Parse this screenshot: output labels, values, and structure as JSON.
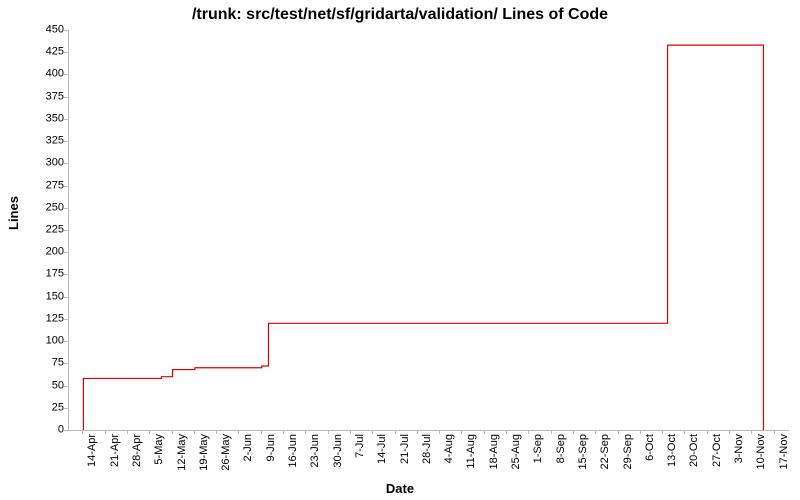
{
  "chart_data": {
    "type": "line",
    "title": "/trunk: src/test/net/sf/gridarta/validation/ Lines of Code",
    "xlabel": "Date",
    "ylabel": "Lines",
    "ylim": [
      0,
      450
    ],
    "y_ticks": [
      0,
      25,
      50,
      75,
      100,
      125,
      150,
      175,
      200,
      225,
      250,
      275,
      300,
      325,
      350,
      375,
      400,
      425,
      450
    ],
    "x_categories": [
      "14-Apr",
      "21-Apr",
      "28-Apr",
      "5-May",
      "12-May",
      "19-May",
      "26-May",
      "2-Jun",
      "9-Jun",
      "16-Jun",
      "23-Jun",
      "30-Jun",
      "7-Jul",
      "14-Jul",
      "21-Jul",
      "28-Jul",
      "4-Aug",
      "11-Aug",
      "18-Aug",
      "25-Aug",
      "1-Sep",
      "8-Sep",
      "15-Sep",
      "22-Sep",
      "29-Sep",
      "6-Oct",
      "13-Oct",
      "20-Oct",
      "27-Oct",
      "3-Nov",
      "10-Nov",
      "17-Nov"
    ],
    "series": [
      {
        "name": "Lines of Code",
        "color": "#e00000",
        "step_points": [
          {
            "x_index": 0.0,
            "y": 0
          },
          {
            "x_index": 0.0,
            "y": 58
          },
          {
            "x_index": 3.5,
            "y": 58
          },
          {
            "x_index": 3.5,
            "y": 60
          },
          {
            "x_index": 4.0,
            "y": 60
          },
          {
            "x_index": 4.0,
            "y": 68
          },
          {
            "x_index": 5.0,
            "y": 68
          },
          {
            "x_index": 5.0,
            "y": 70
          },
          {
            "x_index": 8.0,
            "y": 70
          },
          {
            "x_index": 8.0,
            "y": 72
          },
          {
            "x_index": 8.3,
            "y": 72
          },
          {
            "x_index": 8.3,
            "y": 120
          },
          {
            "x_index": 26.2,
            "y": 120
          },
          {
            "x_index": 26.2,
            "y": 433
          },
          {
            "x_index": 30.5,
            "y": 433
          },
          {
            "x_index": 30.5,
            "y": 0
          }
        ]
      }
    ]
  }
}
